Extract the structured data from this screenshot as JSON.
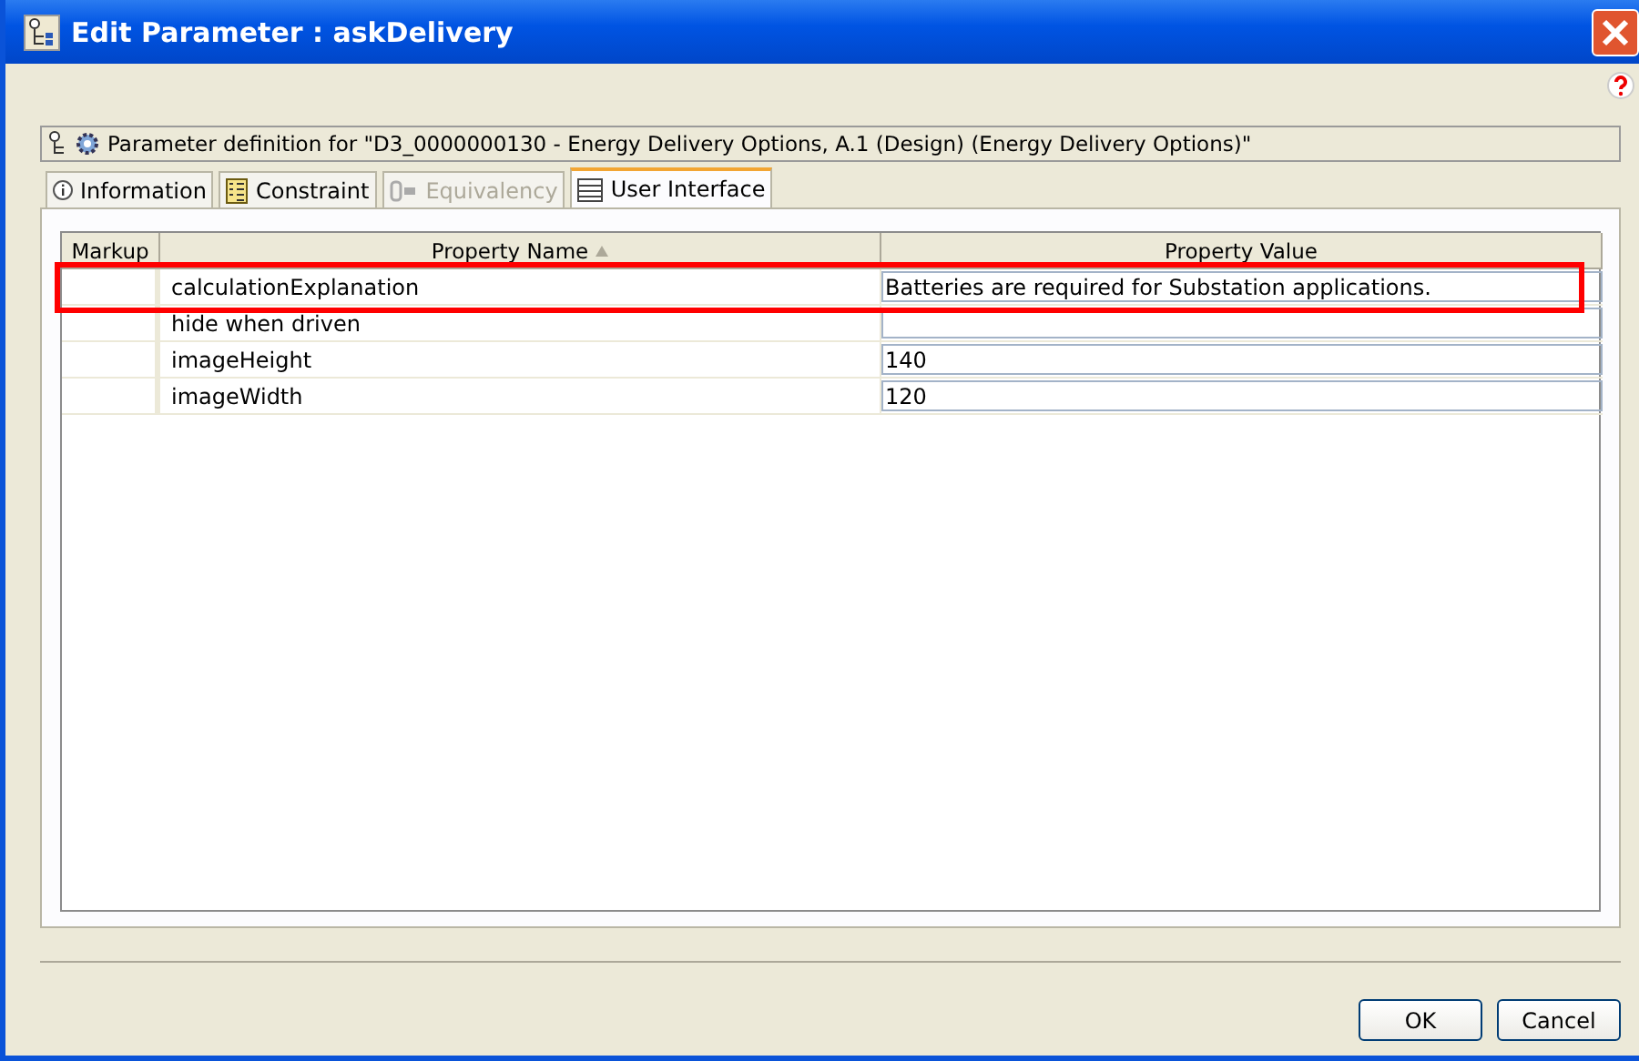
{
  "window": {
    "title": "Edit Parameter : askDelivery"
  },
  "definition": "Parameter definition for \"D3_0000000130 - Energy Delivery Options, A.1 (Design) (Energy Delivery Options)\"",
  "tabs": [
    {
      "label": "Information",
      "kind": "info",
      "selected": false,
      "disabled": false
    },
    {
      "label": "Constraint",
      "kind": "list",
      "selected": false,
      "disabled": false
    },
    {
      "label": "Equivalency",
      "kind": "equiv",
      "selected": false,
      "disabled": true
    },
    {
      "label": "User Interface",
      "kind": "table",
      "selected": true,
      "disabled": false
    }
  ],
  "table": {
    "columns": [
      {
        "label": "Markup",
        "sorted": false
      },
      {
        "label": "Property Name",
        "sorted": true
      },
      {
        "label": "Property Value",
        "sorted": false
      }
    ],
    "rows": [
      {
        "name": "calculationExplanation",
        "value": "Batteries are required for Substation applications.",
        "highlighted": true
      },
      {
        "name": "hide when driven",
        "highlighted": false
      },
      {
        "name": "imageHeight",
        "value": "140",
        "highlighted": false
      },
      {
        "name": "imageWidth",
        "value": "120",
        "highlighted": false
      }
    ]
  },
  "buttons": [
    "OK",
    "Cancel"
  ]
}
